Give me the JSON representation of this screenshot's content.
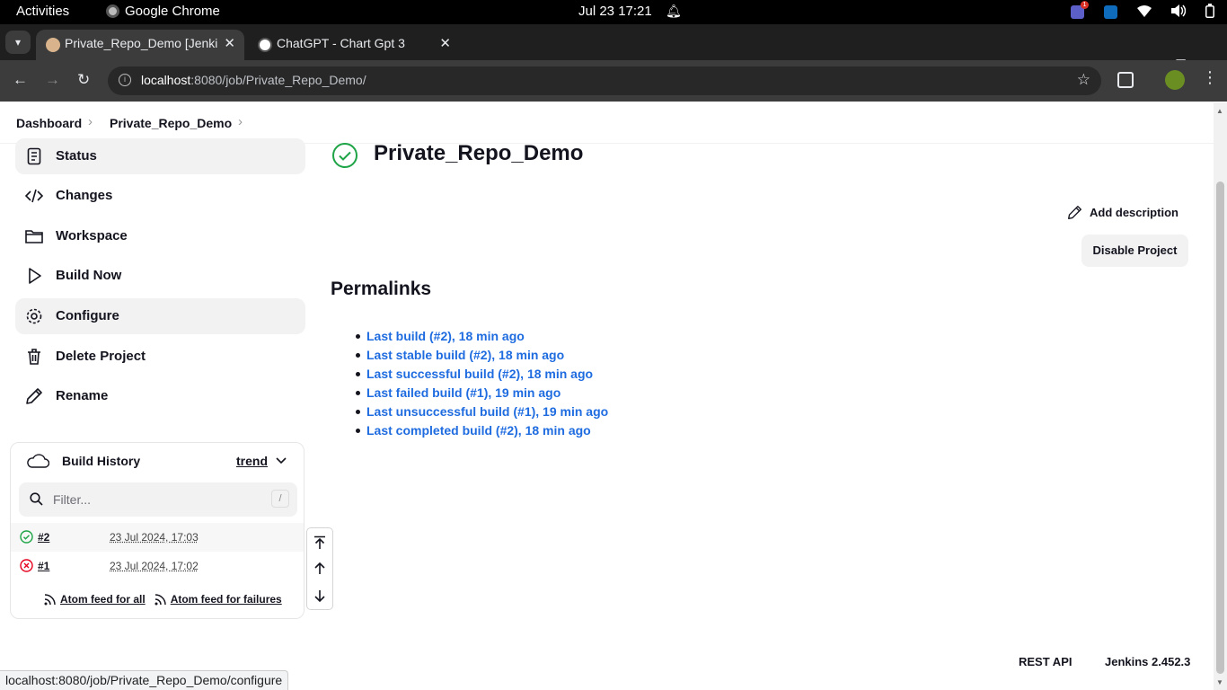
{
  "os_bar": {
    "activities": "Activities",
    "app_name": "Google Chrome",
    "clock": "Jul 23  17:21",
    "teams_badge": "1"
  },
  "browser": {
    "tabs": [
      {
        "title": "Private_Repo_Demo [Jenkins]",
        "active": true
      },
      {
        "title": "ChatGPT - Chart Gpt 3",
        "active": false
      }
    ],
    "url_host": "localhost",
    "url_path": ":8080/job/Private_Repo_Demo/",
    "status_bubble": "localhost:8080/job/Private_Repo_Demo/configure"
  },
  "breadcrumb": {
    "items": [
      "Dashboard",
      "Private_Repo_Demo"
    ]
  },
  "sidebar": {
    "tasks": [
      {
        "label": "Status",
        "icon": "document-icon"
      },
      {
        "label": "Changes",
        "icon": "code-icon"
      },
      {
        "label": "Workspace",
        "icon": "folder-icon"
      },
      {
        "label": "Build Now",
        "icon": "play-icon"
      },
      {
        "label": "Configure",
        "icon": "gear-icon"
      },
      {
        "label": "Delete Project",
        "icon": "trash-icon"
      },
      {
        "label": "Rename",
        "icon": "pencil-icon"
      }
    ]
  },
  "build_history": {
    "title": "Build History",
    "trend_label": "trend",
    "filter_placeholder": "Filter...",
    "filter_shortcut": "/",
    "builds": [
      {
        "number": "#2",
        "date": "23 Jul 2024, 17:03",
        "status": "success"
      },
      {
        "number": "#1",
        "date": "23 Jul 2024, 17:02",
        "status": "failed"
      }
    ],
    "feed_all": "Atom feed for all",
    "feed_failures": "Atom feed for failures"
  },
  "main": {
    "job_title": "Private_Repo_Demo",
    "add_description": "Add description",
    "disable_project": "Disable Project",
    "permalinks_heading": "Permalinks",
    "permalinks": [
      "Last build (#2), 18 min ago",
      "Last stable build (#2), 18 min ago",
      "Last successful build (#2), 18 min ago",
      "Last failed build (#1), 19 min ago",
      "Last unsuccessful build (#1), 19 min ago",
      "Last completed build (#2), 18 min ago"
    ]
  },
  "footer": {
    "rest_api": "REST API",
    "version": "Jenkins 2.452.3"
  },
  "colors": {
    "success": "#1ea446",
    "failure": "#e6001f",
    "link": "#1f6ce0"
  }
}
